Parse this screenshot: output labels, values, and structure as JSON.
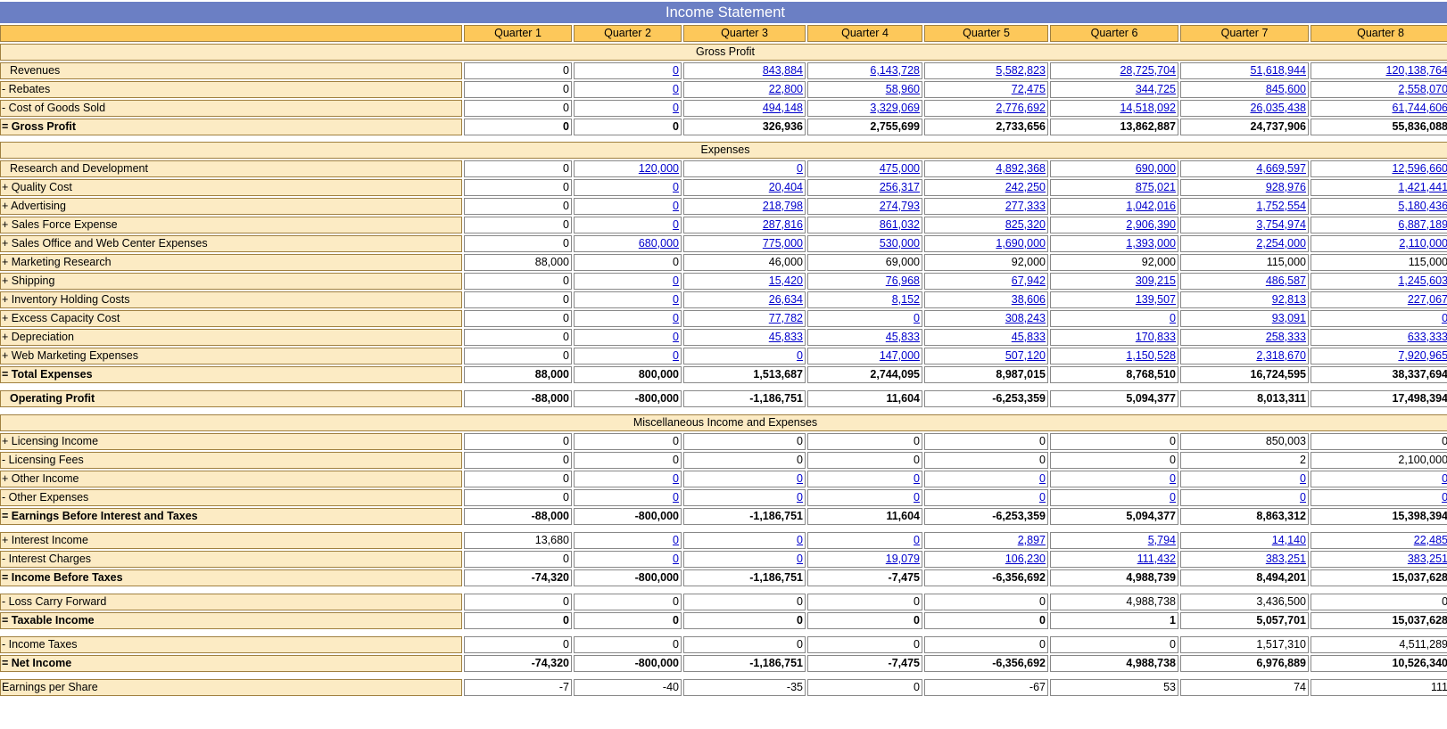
{
  "title": "Income Statement",
  "quarters": [
    "Quarter 1",
    "Quarter 2",
    "Quarter 3",
    "Quarter 4",
    "Quarter 5",
    "Quarter 6",
    "Quarter 7",
    "Quarter 8"
  ],
  "link_color": "#0000cc",
  "rows": [
    {
      "type": "section",
      "label": "Gross Profit"
    },
    {
      "type": "row",
      "label": "Revenues",
      "indent": true,
      "values": [
        "0",
        "0",
        "843,884",
        "6,143,728",
        "5,582,823",
        "28,725,704",
        "51,618,944",
        "120,138,764"
      ],
      "links": [
        false,
        true,
        true,
        true,
        true,
        true,
        true,
        true
      ]
    },
    {
      "type": "row",
      "label": "- Rebates",
      "values": [
        "0",
        "0",
        "22,800",
        "58,960",
        "72,475",
        "344,725",
        "845,600",
        "2,558,070"
      ],
      "links": [
        false,
        true,
        true,
        true,
        true,
        true,
        true,
        true
      ]
    },
    {
      "type": "row",
      "label": "- Cost of Goods Sold",
      "values": [
        "0",
        "0",
        "494,148",
        "3,329,069",
        "2,776,692",
        "14,518,092",
        "26,035,438",
        "61,744,606"
      ],
      "links": [
        false,
        true,
        true,
        true,
        true,
        true,
        true,
        true
      ]
    },
    {
      "type": "row",
      "label": "= Gross Profit",
      "bold": true,
      "values": [
        "0",
        "0",
        "326,936",
        "2,755,699",
        "2,733,656",
        "13,862,887",
        "24,737,906",
        "55,836,088"
      ]
    },
    {
      "type": "gap"
    },
    {
      "type": "section",
      "label": "Expenses"
    },
    {
      "type": "row",
      "label": "Research and Development",
      "indent": true,
      "values": [
        "0",
        "120,000",
        "0",
        "475,000",
        "4,892,368",
        "690,000",
        "4,669,597",
        "12,596,660"
      ],
      "links": [
        false,
        true,
        true,
        true,
        true,
        true,
        true,
        true
      ]
    },
    {
      "type": "row",
      "label": "+ Quality Cost",
      "values": [
        "0",
        "0",
        "20,404",
        "256,317",
        "242,250",
        "875,021",
        "928,976",
        "1,421,441"
      ],
      "links": [
        false,
        true,
        true,
        true,
        true,
        true,
        true,
        true
      ]
    },
    {
      "type": "row",
      "label": "+ Advertising",
      "values": [
        "0",
        "0",
        "218,798",
        "274,793",
        "277,333",
        "1,042,016",
        "1,752,554",
        "5,180,436"
      ],
      "links": [
        false,
        true,
        true,
        true,
        true,
        true,
        true,
        true
      ]
    },
    {
      "type": "row",
      "label": "+ Sales Force Expense",
      "values": [
        "0",
        "0",
        "287,816",
        "861,032",
        "825,320",
        "2,906,390",
        "3,754,974",
        "6,887,189"
      ],
      "links": [
        false,
        true,
        true,
        true,
        true,
        true,
        true,
        true
      ]
    },
    {
      "type": "row",
      "label": "+ Sales Office and Web Center Expenses",
      "values": [
        "0",
        "680,000",
        "775,000",
        "530,000",
        "1,690,000",
        "1,393,000",
        "2,254,000",
        "2,110,000"
      ],
      "links": [
        false,
        true,
        true,
        true,
        true,
        true,
        true,
        true
      ]
    },
    {
      "type": "row",
      "label": "+ Marketing Research",
      "values": [
        "88,000",
        "0",
        "46,000",
        "69,000",
        "92,000",
        "92,000",
        "115,000",
        "115,000"
      ]
    },
    {
      "type": "row",
      "label": "+ Shipping",
      "values": [
        "0",
        "0",
        "15,420",
        "76,968",
        "67,942",
        "309,215",
        "486,587",
        "1,245,603"
      ],
      "links": [
        false,
        true,
        true,
        true,
        true,
        true,
        true,
        true
      ]
    },
    {
      "type": "row",
      "label": "+ Inventory Holding Costs",
      "values": [
        "0",
        "0",
        "26,634",
        "8,152",
        "38,606",
        "139,507",
        "92,813",
        "227,067"
      ],
      "links": [
        false,
        true,
        true,
        true,
        true,
        true,
        true,
        true
      ]
    },
    {
      "type": "row",
      "label": "+ Excess Capacity Cost",
      "values": [
        "0",
        "0",
        "77,782",
        "0",
        "308,243",
        "0",
        "93,091",
        "0"
      ],
      "links": [
        false,
        true,
        true,
        true,
        true,
        true,
        true,
        true
      ]
    },
    {
      "type": "row",
      "label": "+ Depreciation",
      "values": [
        "0",
        "0",
        "45,833",
        "45,833",
        "45,833",
        "170,833",
        "258,333",
        "633,333"
      ],
      "links": [
        false,
        true,
        true,
        true,
        true,
        true,
        true,
        true
      ]
    },
    {
      "type": "row",
      "label": "+ Web Marketing Expenses",
      "values": [
        "0",
        "0",
        "0",
        "147,000",
        "507,120",
        "1,150,528",
        "2,318,670",
        "7,920,965"
      ],
      "links": [
        false,
        true,
        true,
        true,
        true,
        true,
        true,
        true
      ]
    },
    {
      "type": "row",
      "label": "= Total Expenses",
      "bold": true,
      "values": [
        "88,000",
        "800,000",
        "1,513,687",
        "2,744,095",
        "8,987,015",
        "8,768,510",
        "16,724,595",
        "38,337,694"
      ]
    },
    {
      "type": "gap2"
    },
    {
      "type": "row",
      "label": "Operating Profit",
      "indent": true,
      "bold": true,
      "values": [
        "-88,000",
        "-800,000",
        "-1,186,751",
        "11,604",
        "-6,253,359",
        "5,094,377",
        "8,013,311",
        "17,498,394"
      ]
    },
    {
      "type": "gap2"
    },
    {
      "type": "section",
      "label": "Miscellaneous Income and Expenses"
    },
    {
      "type": "row",
      "label": "+ Licensing Income",
      "values": [
        "0",
        "0",
        "0",
        "0",
        "0",
        "0",
        "850,003",
        "0"
      ]
    },
    {
      "type": "row",
      "label": "- Licensing Fees",
      "values": [
        "0",
        "0",
        "0",
        "0",
        "0",
        "0",
        "2",
        "2,100,000"
      ]
    },
    {
      "type": "row",
      "label": "+ Other Income",
      "values": [
        "0",
        "0",
        "0",
        "0",
        "0",
        "0",
        "0",
        "0"
      ],
      "links": [
        false,
        true,
        true,
        true,
        true,
        true,
        true,
        true
      ]
    },
    {
      "type": "row",
      "label": "- Other Expenses",
      "values": [
        "0",
        "0",
        "0",
        "0",
        "0",
        "0",
        "0",
        "0"
      ],
      "links": [
        false,
        true,
        true,
        true,
        true,
        true,
        true,
        true
      ]
    },
    {
      "type": "row",
      "label": "= Earnings Before Interest and Taxes",
      "bold": true,
      "values": [
        "-88,000",
        "-800,000",
        "-1,186,751",
        "11,604",
        "-6,253,359",
        "5,094,377",
        "8,863,312",
        "15,398,394"
      ]
    },
    {
      "type": "gap2"
    },
    {
      "type": "row",
      "label": "+ Interest Income",
      "values": [
        "13,680",
        "0",
        "0",
        "0",
        "2,897",
        "5,794",
        "14,140",
        "22,485"
      ],
      "links": [
        false,
        true,
        true,
        true,
        true,
        true,
        true,
        true
      ]
    },
    {
      "type": "row",
      "label": "- Interest Charges",
      "values": [
        "0",
        "0",
        "0",
        "19,079",
        "106,230",
        "111,432",
        "383,251",
        "383,251"
      ],
      "links": [
        false,
        true,
        true,
        true,
        true,
        true,
        true,
        true
      ]
    },
    {
      "type": "row",
      "label": "= Income Before Taxes",
      "bold": true,
      "values": [
        "-74,320",
        "-800,000",
        "-1,186,751",
        "-7,475",
        "-6,356,692",
        "4,988,739",
        "8,494,201",
        "15,037,628"
      ]
    },
    {
      "type": "gap2"
    },
    {
      "type": "row",
      "label": "- Loss Carry Forward",
      "values": [
        "0",
        "0",
        "0",
        "0",
        "0",
        "4,988,738",
        "3,436,500",
        "0"
      ]
    },
    {
      "type": "row",
      "label": "= Taxable Income",
      "bold": true,
      "values": [
        "0",
        "0",
        "0",
        "0",
        "0",
        "1",
        "5,057,701",
        "15,037,628"
      ]
    },
    {
      "type": "gap2"
    },
    {
      "type": "row",
      "label": "- Income Taxes",
      "values": [
        "0",
        "0",
        "0",
        "0",
        "0",
        "0",
        "1,517,310",
        "4,511,289"
      ]
    },
    {
      "type": "row",
      "label": "= Net Income",
      "bold": true,
      "values": [
        "-74,320",
        "-800,000",
        "-1,186,751",
        "-7,475",
        "-6,356,692",
        "4,988,738",
        "6,976,889",
        "10,526,340"
      ]
    },
    {
      "type": "gap2"
    },
    {
      "type": "row",
      "label": "Earnings per Share",
      "values": [
        "-7",
        "-40",
        "-35",
        "0",
        "-67",
        "53",
        "74",
        "111"
      ]
    }
  ]
}
